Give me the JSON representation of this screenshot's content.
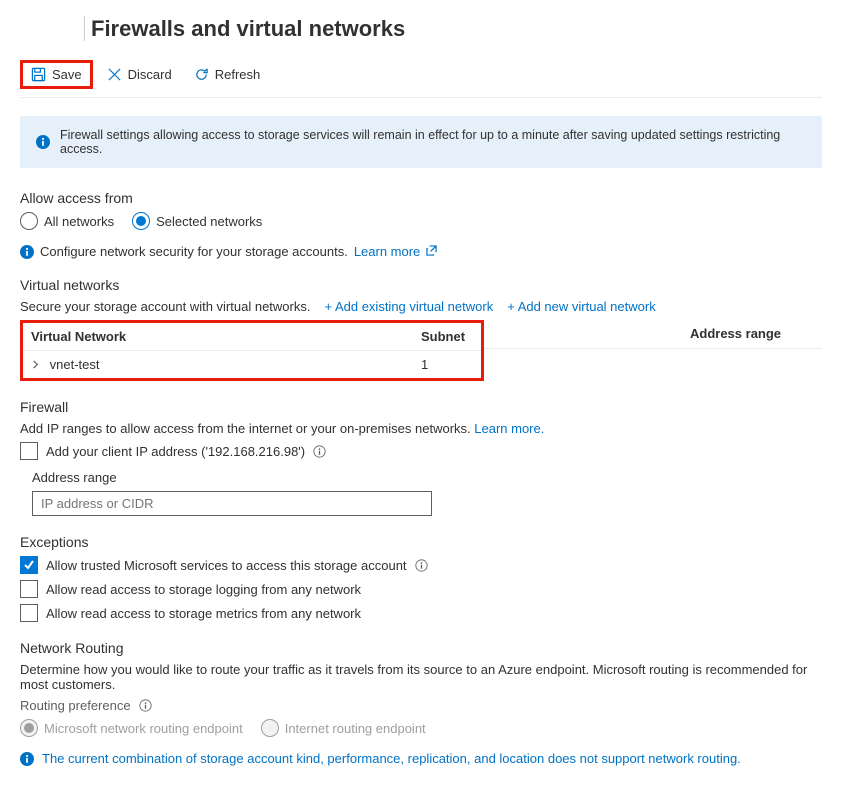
{
  "pageTitle": "Firewalls and virtual networks",
  "toolbar": {
    "save": "Save",
    "discard": "Discard",
    "refresh": "Refresh"
  },
  "banner": "Firewall settings allowing access to storage services will remain in effect for up to a minute after saving updated settings restricting access.",
  "access": {
    "heading": "Allow access from",
    "all": "All networks",
    "selected": "Selected networks",
    "configure": "Configure network security for your storage accounts.",
    "learnMore": "Learn more"
  },
  "vnet": {
    "heading": "Virtual networks",
    "desc": "Secure your storage account with virtual networks.",
    "addExisting": "+ Add existing virtual network",
    "addNew": "+ Add new virtual network",
    "colVnet": "Virtual Network",
    "colSubnet": "Subnet",
    "colAddr": "Address range",
    "rowName": "vnet-test",
    "rowSubnet": "1"
  },
  "firewall": {
    "heading": "Firewall",
    "desc": "Add IP ranges to allow access from the internet or your on-premises networks.",
    "learnMore": "Learn more.",
    "clientIp": "Add your client IP address ('192.168.216.98')",
    "addrLabel": "Address range",
    "placeholder": "IP address or CIDR"
  },
  "exceptions": {
    "heading": "Exceptions",
    "trusted": "Allow trusted Microsoft services to access this storage account",
    "logging": "Allow read access to storage logging from any network",
    "metrics": "Allow read access to storage metrics from any network"
  },
  "routing": {
    "heading": "Network Routing",
    "desc": "Determine how you would like to route your traffic as it travels from its source to an Azure endpoint. Microsoft routing is recommended for most customers.",
    "prefLabel": "Routing preference",
    "ms": "Microsoft network routing endpoint",
    "internet": "Internet routing endpoint",
    "warn": "The current combination of storage account kind, performance, replication, and location does not support network routing."
  }
}
